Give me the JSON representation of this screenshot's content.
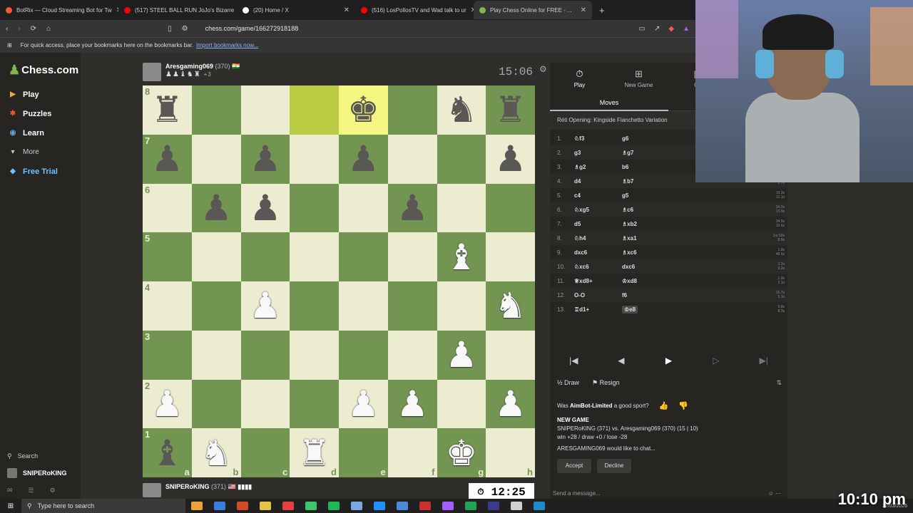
{
  "browser": {
    "tabs": [
      {
        "label": "BotRix — Cloud Streaming Bot for Tw",
        "color": "#f25b2e"
      },
      {
        "label": "(517) STEEL BALL RUN JoJo's Bizarre",
        "color": "#ff0000"
      },
      {
        "label": "(20) Home / X",
        "color": "#ffffff"
      },
      {
        "label": "(516) LosPollosTV and Wad talk to ur",
        "color": "#ff0000"
      },
      {
        "label": "Play Chess Online for FREE - ...",
        "color": "#81b64c"
      }
    ],
    "url": "chess.com/game/166272918188",
    "bookmarks_text": "For quick access, place your bookmarks here on the bookmarks bar.",
    "bookmarks_link": "Import bookmarks now..."
  },
  "sidebar": {
    "logo": "Chess.com",
    "items": [
      {
        "label": "Play",
        "icon": "play-icon",
        "color": "#f0a64a"
      },
      {
        "label": "Puzzles",
        "icon": "puzzle-icon",
        "color": "#e35a2a"
      },
      {
        "label": "Learn",
        "icon": "learn-icon",
        "color": "#5ba1d8"
      },
      {
        "label": "More",
        "icon": "chevron-down-icon",
        "color": "#ccc"
      },
      {
        "label": "Free Trial",
        "icon": "diamond-icon",
        "color": "#6fc2ff"
      }
    ],
    "search": "Search",
    "user": "SNIPERoKING"
  },
  "game": {
    "top_player": {
      "name": "Aresgaming069",
      "rating": "(370)",
      "flag": "🇮🇳",
      "captured": "♟♟♝♞♜",
      "diff": "+3"
    },
    "top_clock": "15:06",
    "bottom_player": {
      "name": "SNIPERoKING",
      "rating": "(371)",
      "flag": "🇺🇸",
      "captured": "▮▮▮▮"
    },
    "bottom_clock": "12:25",
    "board": [
      [
        "bR",
        "",
        "",
        "",
        "bK",
        "",
        "bN",
        "bR"
      ],
      [
        "bP",
        "",
        "bP",
        "",
        "bP",
        "",
        "",
        "bP"
      ],
      [
        "",
        "bP",
        "bP",
        "",
        "",
        "bP",
        "",
        ""
      ],
      [
        "",
        "",
        "",
        "",
        "",
        "",
        "wB",
        ""
      ],
      [
        "",
        "",
        "wP",
        "",
        "",
        "",
        "",
        "wN"
      ],
      [
        "",
        "",
        "",
        "",
        "",
        "",
        "wP",
        ""
      ],
      [
        "wP",
        "",
        "",
        "",
        "wP",
        "wP",
        "",
        "wP"
      ],
      [
        "bB",
        "wN",
        "",
        "wR",
        "",
        "",
        "wK",
        ""
      ]
    ],
    "ranks": [
      "8",
      "7",
      "6",
      "5",
      "4",
      "3",
      "2",
      "1"
    ],
    "files": [
      "a",
      "b",
      "c",
      "d",
      "e",
      "f",
      "g",
      "h"
    ]
  },
  "panel": {
    "tabs": [
      {
        "label": "Play",
        "icon": "stopwatch-icon"
      },
      {
        "label": "New Game",
        "icon": "plus-icon"
      },
      {
        "label": "Ga",
        "icon": "games-icon"
      }
    ],
    "subtab": "Moves",
    "opening": "Réti Opening: Kingside Fianchetto Variation",
    "moves": [
      {
        "n": "1.",
        "w": "♘f3",
        "b": "g6",
        "tw": "",
        "tb": ""
      },
      {
        "n": "2.",
        "w": "g3",
        "b": "♗g7",
        "tw": "",
        "tb": ""
      },
      {
        "n": "3.",
        "w": "♗g2",
        "b": "b6",
        "tw": "",
        "tb": ""
      },
      {
        "n": "4.",
        "w": "d4",
        "b": "♗b7",
        "tw": "2.7s",
        "tb": "2.7s"
      },
      {
        "n": "5.",
        "w": "c4",
        "b": "g5",
        "tw": "10.3s",
        "tb": "12.1s"
      },
      {
        "n": "6.",
        "w": "♘xg5",
        "b": "♗c6",
        "tw": "34.9s",
        "tb": "13.9s"
      },
      {
        "n": "7.",
        "w": "d5",
        "b": "♗xb2",
        "tw": "34.0s",
        "tb": "10.6s"
      },
      {
        "n": "8.",
        "w": "♘h4",
        "b": "♗xa1",
        "tw": "1m 50s",
        "tb": "8.5s"
      },
      {
        "n": "9.",
        "w": "dxc6",
        "b": "♗xc6",
        "tw": "1.8s",
        "tb": "48.6s"
      },
      {
        "n": "10.",
        "w": "♘xc6",
        "b": "dxc6",
        "tw": "3.3s",
        "tb": "9.2s"
      },
      {
        "n": "11.",
        "w": "♕xd8+",
        "b": "♔xd8",
        "tw": "1.9s",
        "tb": "2.1s"
      },
      {
        "n": "12.",
        "w": "O-O",
        "b": "f6",
        "tw": "15.7s",
        "tb": "5.1s"
      },
      {
        "n": "13.",
        "w": "♖d1+",
        "b": "♔e8",
        "tw": "9.8s",
        "tb": "8.3s"
      }
    ],
    "actions": {
      "draw": "Draw",
      "resign": "Resign"
    },
    "chat": {
      "sport_q": "Was",
      "sport_name": "AimBot-Limited",
      "sport_tail": "a good sport?",
      "newgame": "NEW GAME",
      "vs_line": "SNIPERoKING (371) vs. Aresgaming069 (370) (15 | 10)",
      "odds": "win +28 / draw +0 / lose -28",
      "invite": "ARESGAMING069 would like to chat...",
      "accept": "Accept",
      "decline": "Decline",
      "send_placeholder": "Send a message..."
    }
  },
  "taskbar": {
    "search_placeholder": "Type here to search",
    "time": "10:10 pm",
    "date": "22/03/2026",
    "apps": [
      "#e8a33d",
      "#3a7ee0",
      "#d14b2a",
      "#e3c449",
      "#e34141",
      "#3ec46d",
      "#1db954",
      "#7aa9e6",
      "#1e90ff",
      "#4d8ad8",
      "#cc2f2f",
      "#a35cff",
      "#23a455",
      "#3c3c8c",
      "#d2d2d2",
      "#1f8acb"
    ]
  }
}
